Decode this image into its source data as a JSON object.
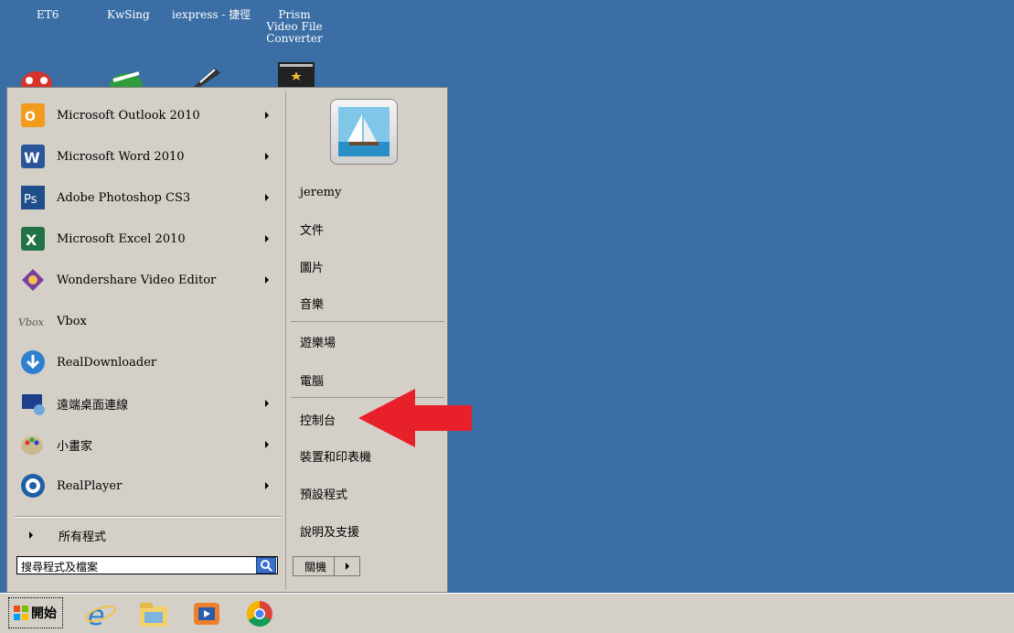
{
  "desktop": {
    "labels": [
      {
        "text": "ET6"
      },
      {
        "text": "KwSing"
      },
      {
        "text": "iexpress - 捷徑"
      },
      {
        "text": "Prism Video File Converter"
      }
    ]
  },
  "start_menu": {
    "programs": [
      {
        "label": "Microsoft Outlook 2010",
        "icon": "outlook-icon",
        "has_submenu": true
      },
      {
        "label": "Microsoft Word 2010",
        "icon": "word-icon",
        "has_submenu": true
      },
      {
        "label": "Adobe Photoshop CS3",
        "icon": "photoshop-icon",
        "has_submenu": true
      },
      {
        "label": "Microsoft Excel 2010",
        "icon": "excel-icon",
        "has_submenu": true
      },
      {
        "label": "Wondershare Video Editor",
        "icon": "wondershare-icon",
        "has_submenu": true
      },
      {
        "label": "Vbox",
        "icon": "vbox-icon",
        "has_submenu": false
      },
      {
        "label": "RealDownloader",
        "icon": "realdownloader-icon",
        "has_submenu": false
      },
      {
        "label": "遠端桌面連線",
        "icon": "remote-desktop-icon",
        "has_submenu": true
      },
      {
        "label": "小畫家",
        "icon": "paint-icon",
        "has_submenu": true
      },
      {
        "label": "RealPlayer",
        "icon": "realplayer-icon",
        "has_submenu": true
      }
    ],
    "all_programs": "所有程式",
    "search_placeholder": "搜尋程式及檔案",
    "right_items": [
      {
        "label": "jeremy"
      },
      {
        "label": "文件"
      },
      {
        "label": "圖片"
      },
      {
        "label": "音樂"
      },
      {
        "label": "遊樂場"
      },
      {
        "label": "電腦"
      },
      {
        "label": "控制台"
      },
      {
        "label": "裝置和印表機"
      },
      {
        "label": "預設程式"
      },
      {
        "label": "說明及支援"
      }
    ],
    "shutdown_label": "關機"
  },
  "taskbar": {
    "start_label": "開始",
    "pinned": [
      "ie-icon",
      "explorer-icon",
      "media-player-icon",
      "chrome-icon"
    ]
  },
  "colors": {
    "desktop": "#3a6ea5",
    "menu": "#d4d0c8",
    "annotation_arrow": "#e8202a"
  }
}
